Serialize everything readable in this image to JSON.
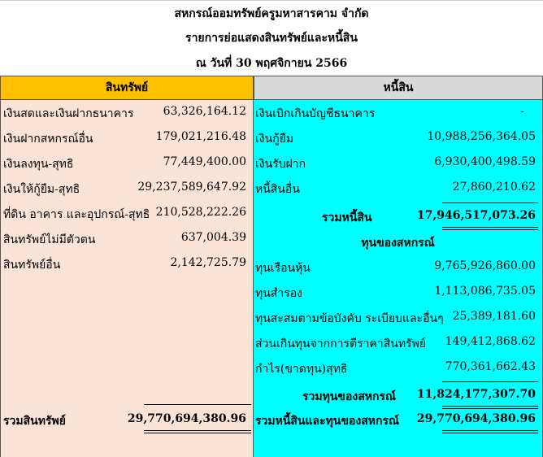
{
  "header": {
    "org": "สหกรณ์ออมทรัพย์ครูมหาสารคาม  จำกัด",
    "report": "รายการย่อแสดงสินทรัพย์และหนี้สิน",
    "date": "ณ  วันที่  30 พฤศจิกายน 2566"
  },
  "assets": {
    "heading": "สินทรัพย์",
    "items": [
      {
        "label": "เงินสดและเงินฝากธนาคาร",
        "value": "63,326,164.12"
      },
      {
        "label": "เงินฝากสหกรณ์อื่น",
        "value": "179,021,216.48"
      },
      {
        "label": "เงินลงทุน-สุทธิ",
        "value": "77,449,400.00"
      },
      {
        "label": "เงินให้กู้ยืม-สุทธิ",
        "value": "29,237,589,647.92"
      },
      {
        "label": "ที่ดิน อาคาร และอุปกรณ์-สุทธิ",
        "value": "210,528,222.26"
      },
      {
        "label": "สินทรัพย์ไม่มีตัวตน",
        "value": "637,004.39"
      },
      {
        "label": "สินทรัพย์อื่น",
        "value": "2,142,725.79"
      }
    ],
    "total_label": "รวมสินทรัพย์",
    "total_value": "29,770,694,380.96"
  },
  "liabilities": {
    "heading": "หนี้สิน",
    "items": [
      {
        "label": "เงินเบิกเกินบัญชีธนาคาร",
        "value": "-"
      },
      {
        "label": "เงินกู้ยืม",
        "value": "10,988,256,364.05"
      },
      {
        "label": "เงินรับฝาก",
        "value": "6,930,400,498.59"
      },
      {
        "label": "หนี้สินอื่น",
        "value": "27,860,210.62"
      }
    ],
    "total_label": "รวมหนี้สิน",
    "total_value": "17,946,517,073.26"
  },
  "equity": {
    "heading": "ทุนของสหกรณ์",
    "items": [
      {
        "label": "ทุนเรือนหุ้น",
        "value": "9,765,926,860.00"
      },
      {
        "label": "ทุนสำรอง",
        "value": "1,113,086,735.05"
      },
      {
        "label": "ทุนสะสมตามข้อบังคับ ระเบียบและอื่นๆ",
        "value": "25,389,181.60"
      },
      {
        "label": "ส่วนเกินทุนจากการตีราคาสินทรัพย์",
        "value": "149,412,868.62"
      },
      {
        "label": "กำไร(ขาดทุน)สุทธิ",
        "value": "770,361,662.43"
      }
    ],
    "total_label": "รวมทุนของสหกรณ์",
    "total_value": "11,824,177,307.70"
  },
  "grand_total": {
    "label": "รวมหนี้สินและทุนของสหกรณ์",
    "value": "29,770,694,380.96"
  },
  "colors": {
    "assets_header": "#ffc000",
    "assets_bg": "#fbe3d6",
    "liabilities_header": "#d9d9d9",
    "liabilities_bg": "#00ffff"
  }
}
